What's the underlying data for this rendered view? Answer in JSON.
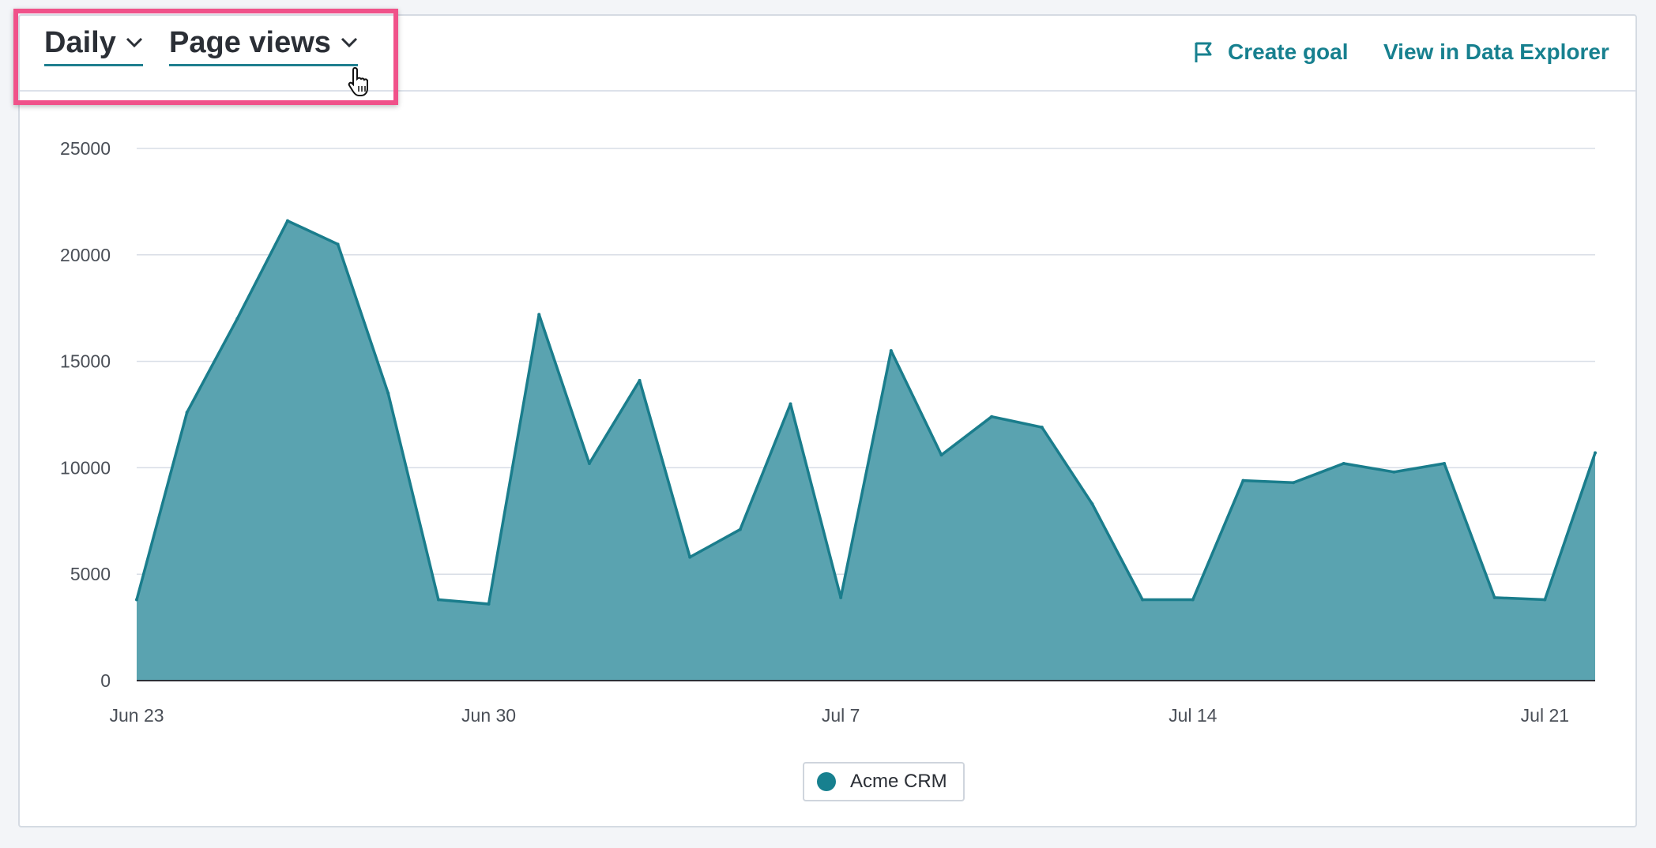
{
  "controls": {
    "interval_label": "Daily",
    "metric_label": "Page views",
    "create_goal_label": "Create goal",
    "data_explorer_label": "View in Data Explorer"
  },
  "colors": {
    "accent": "#17808f",
    "area_fill": "#5aa3b0",
    "area_stroke": "#1a7d8c",
    "highlight": "#f0528a"
  },
  "chart_data": {
    "type": "area",
    "title": "",
    "xlabel": "",
    "ylabel": "",
    "ylim": [
      0,
      25000
    ],
    "yticks": [
      0,
      5000,
      10000,
      15000,
      20000,
      25000
    ],
    "x_tick_labels": [
      "Jun 23",
      "Jun 30",
      "Jul 7",
      "Jul 14",
      "Jul 21"
    ],
    "x_tick_positions_days": [
      0,
      7,
      14,
      21,
      28
    ],
    "grid": true,
    "legend_position": "bottom-center",
    "categories": [
      "Jun 23",
      "Jun 24",
      "Jun 25",
      "Jun 26",
      "Jun 27",
      "Jun 28",
      "Jun 29",
      "Jun 30",
      "Jul 1",
      "Jul 2",
      "Jul 3",
      "Jul 4",
      "Jul 5",
      "Jul 6",
      "Jul 7",
      "Jul 8",
      "Jul 9",
      "Jul 10",
      "Jul 11",
      "Jul 12",
      "Jul 13",
      "Jul 14",
      "Jul 15",
      "Jul 16",
      "Jul 17",
      "Jul 18",
      "Jul 19",
      "Jul 20",
      "Jul 21",
      "Jul 22"
    ],
    "series": [
      {
        "name": "Acme CRM",
        "values": [
          3800,
          12600,
          17000,
          21600,
          20500,
          13500,
          3800,
          3600,
          17200,
          10200,
          14100,
          5800,
          7100,
          13000,
          3900,
          15500,
          10600,
          12400,
          11900,
          8300,
          3800,
          3800,
          9400,
          9300,
          10200,
          9800,
          10200,
          3900,
          3800,
          10700
        ]
      }
    ]
  }
}
